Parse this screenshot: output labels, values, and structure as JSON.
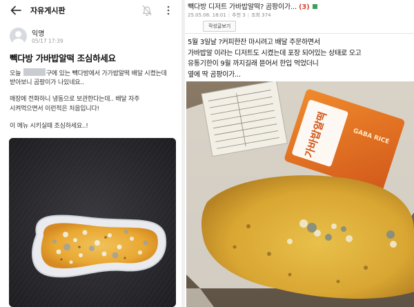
{
  "left": {
    "board_title": "자유게시판",
    "author": "익명",
    "date": "05/17 17:39",
    "title": "빽다방 가바밥알떡 조심하세요",
    "body": {
      "l1a": "오늘",
      "l1b": "구에 있는 빽다방에서 가가밥알떡 배달 시켰는데",
      "l2": "받아보니 곰팡이가 나있네요..",
      "l3": "매장에 전화하니 냉동으로 보관한다는데.. 배달 자주",
      "l4": "시켜먹으면서 이런적은 처음입니다!",
      "l5": "이 메뉴 시키실때 조심하세요..!"
    },
    "icons": [
      "back-arrow-icon",
      "bell-off-icon",
      "more-vertical-icon"
    ]
  },
  "right": {
    "title": "빽다방 디저트 가바밥알떡? 곰팡이가...",
    "comment_count": "(3)",
    "meta": {
      "datetime": "25.05.08. 18:01",
      "recommend": "추천 3",
      "views": "조회 374"
    },
    "author_posts_button": "작성글보기",
    "body_lines": [
      "5월 3일날 ?커피한잔 마시려고 배달 주문하면서",
      "가바밥알 이라는 디저트도 시켰는데 포장 되어있는 상태로 오고",
      "유통기한이 9월 까지길래 뜯어서 한입 먹었더니",
      "옆에 딱 곰팡이가..."
    ],
    "package_text": "가바밥알떡",
    "package_subtext": "GABA RICE"
  },
  "colors": {
    "mold_yellow": "#e9a833",
    "package_orange": "#e06a1e",
    "count_red": "#d24a3a"
  }
}
